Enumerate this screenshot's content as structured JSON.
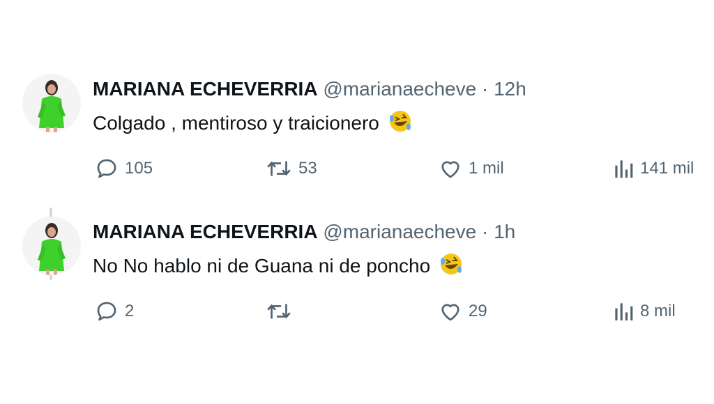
{
  "tweets": [
    {
      "author_name": "MARIANA ECHEVERRIA",
      "handle": "@marianaecheve",
      "separator": "·",
      "time": "12h",
      "text": "Colgado , mentiroso y traicionero",
      "emoji_icon": "rolling-on-floor-laughing-icon",
      "replies": "105",
      "retweets": "53",
      "likes": "1 mil",
      "views": "141 mil"
    },
    {
      "author_name": "MARIANA ECHEVERRIA",
      "handle": "@marianaecheve",
      "separator": "·",
      "time": "1h",
      "text": "No No hablo ni de Guana ni de poncho",
      "emoji_icon": "rolling-on-floor-laughing-icon",
      "replies": "2",
      "retweets": "",
      "likes": "29",
      "views": "8 mil"
    }
  ],
  "colors": {
    "text_primary": "#0f1419",
    "text_secondary": "#536471",
    "thread_line": "#cfd9de",
    "avatar_outfit": "#3ed12b"
  }
}
